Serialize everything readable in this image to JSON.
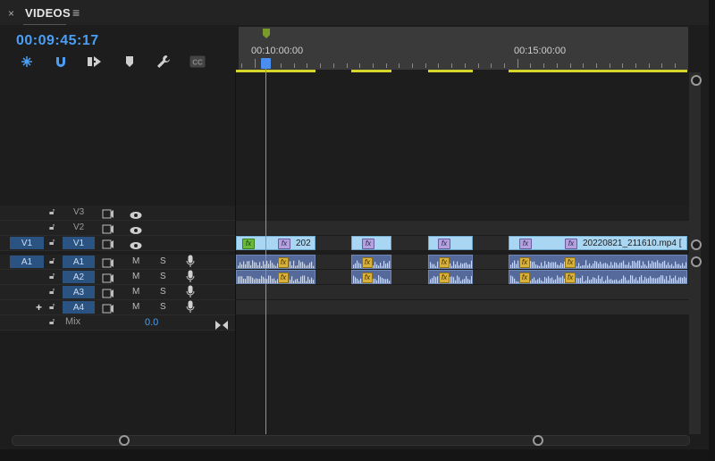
{
  "panel": {
    "close_glyph": "×",
    "title": "VIDEOS",
    "menu_glyph": "≡"
  },
  "timecode": "00:09:45:17",
  "toolbar": {
    "tools": [
      "insert-snap-icon",
      "magnet-icon",
      "linked-selection-icon",
      "add-marker-icon",
      "wrench-icon",
      "captions-icon"
    ],
    "captions_label": "CC"
  },
  "ruler": {
    "labels": [
      "00:10:00:00",
      "00:15:00:00"
    ]
  },
  "tracks": {
    "video": [
      {
        "label": "V3",
        "source": ""
      },
      {
        "label": "V2",
        "source": ""
      },
      {
        "label": "V1",
        "source": "V1"
      }
    ],
    "audio": [
      {
        "label": "A1",
        "source": "A1",
        "mute": "M",
        "solo": "S"
      },
      {
        "label": "A2",
        "source": "",
        "mute": "M",
        "solo": "S"
      },
      {
        "label": "A3",
        "source": "",
        "mute": "M",
        "solo": "S"
      },
      {
        "label": "A4",
        "source": "",
        "mute": "M",
        "solo": "S"
      }
    ],
    "mix": {
      "label": "Mix",
      "value": "0.0"
    },
    "add_glyph": "+"
  },
  "clips": {
    "fx_label": "fx",
    "v1_first_name": "202",
    "v1_last_name": "20220821_211610.mp4 ["
  },
  "colors": {
    "accent": "#4a9ff5",
    "video_clip": "#a9d6f2",
    "audio_clip": "#556a9a",
    "work_area": "#d6d62a"
  }
}
